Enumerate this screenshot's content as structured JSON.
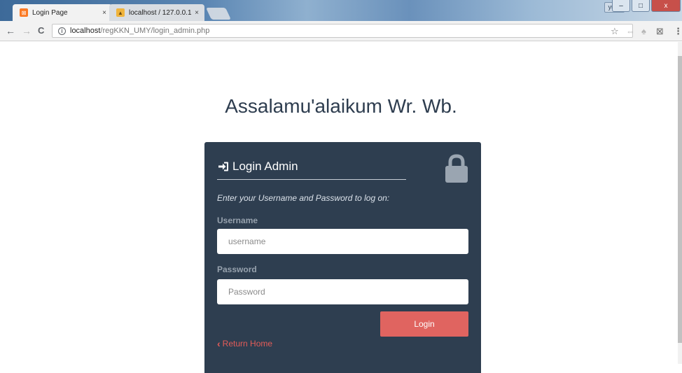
{
  "browser": {
    "tabs": [
      {
        "title": "Login Page",
        "close": "×",
        "favicon": "xampp-icon"
      },
      {
        "title": "localhost / 127.0.0.1 | ph",
        "close": "×",
        "favicon": "phpmyadmin-icon"
      }
    ],
    "window": {
      "user_label": "yulia",
      "minimize": "–",
      "maximize": "□",
      "close": "x"
    },
    "nav": {
      "back": "←",
      "forward": "→",
      "reload": "C"
    },
    "address": {
      "host": "localhost",
      "path": "/regKKN_UMY/login_admin.php"
    },
    "extensions": {
      "star": "☆",
      "ext1": "⇔",
      "ext2": "♠",
      "ext3": "⊠",
      "menu": "⋮"
    }
  },
  "page": {
    "greeting": "Assalamu'alaikum Wr. Wb.",
    "card": {
      "title": "Login Admin",
      "hint": "Enter your Username and Password to log on:",
      "username_label": "Username",
      "username_placeholder": "username",
      "password_label": "Password",
      "password_placeholder": "Password",
      "login_button": "Login",
      "return_link": "Return Home"
    }
  },
  "colors": {
    "card_bg": "#2e3e50",
    "accent": "#e06460",
    "heading": "#2e3d4f"
  }
}
